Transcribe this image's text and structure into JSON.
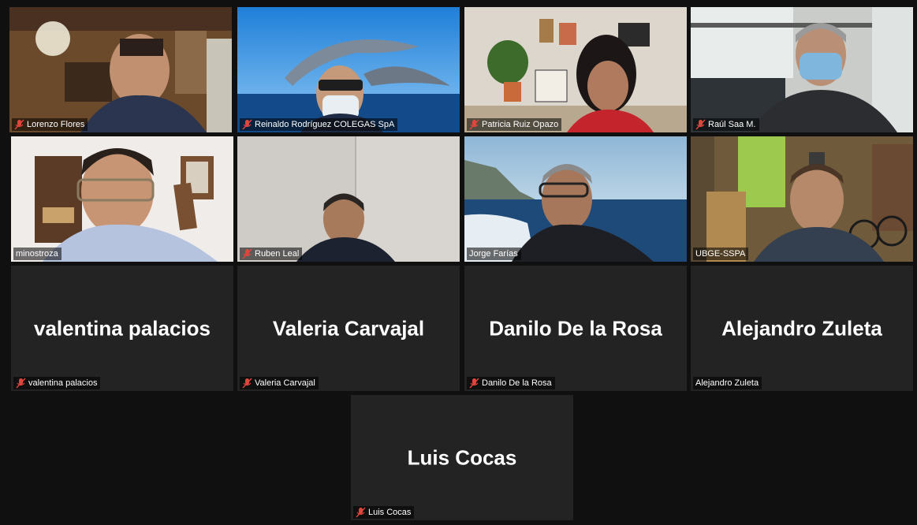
{
  "participants": [
    {
      "name": "Lorenzo Flores",
      "muted": true,
      "video": true,
      "active": true
    },
    {
      "name": "Reinaldo Rodríguez  COLEGAS SpA",
      "muted": true,
      "video": true
    },
    {
      "name": "Patricia Ruiz Opazo",
      "muted": true,
      "video": true
    },
    {
      "name": "Raúl Saa M.",
      "muted": true,
      "video": true
    },
    {
      "name": "minostroza",
      "muted": false,
      "video": true
    },
    {
      "name": "Ruben Leal",
      "muted": true,
      "video": true
    },
    {
      "name": "Jorge Farías",
      "muted": false,
      "video": true
    },
    {
      "name": "UBGE-SSPA",
      "muted": false,
      "video": true
    },
    {
      "name": "valentina palacios",
      "muted": true,
      "video": false
    },
    {
      "name": "Valeria Carvajal",
      "muted": true,
      "video": false
    },
    {
      "name": "Danilo De la Rosa",
      "muted": true,
      "video": false
    },
    {
      "name": "Alejandro Zuleta",
      "muted": false,
      "video": false
    },
    {
      "name": "Luis Cocas",
      "muted": true,
      "video": false
    }
  ],
  "colors": {
    "active_speaker_border": "#d7e04a",
    "muted_icon": "#e0463c",
    "tile_bg": "#232323"
  },
  "icons": {
    "muted": "mic-muted-icon"
  }
}
